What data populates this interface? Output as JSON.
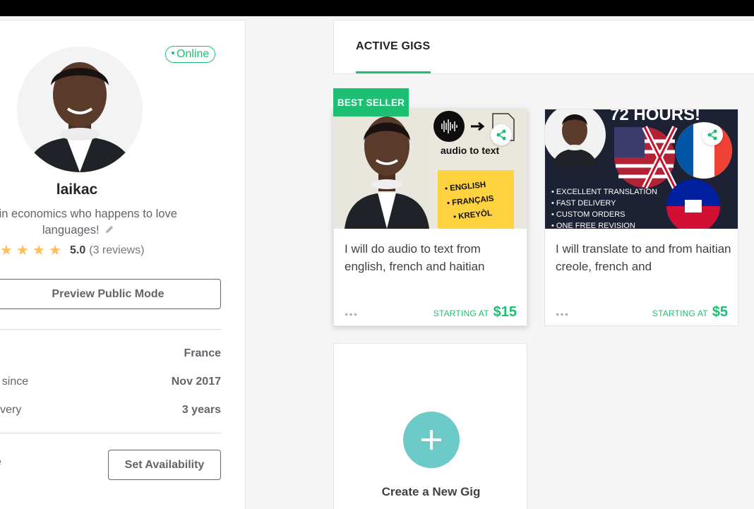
{
  "profile": {
    "status": "Online",
    "username": "laikac",
    "bio": "ent in economics who happens to love languages!",
    "rating_score": "5.0",
    "rating_count": "(3 reviews)",
    "stars": 5,
    "preview_button": "Preview Public Mode",
    "info": [
      {
        "label": "",
        "value": "France"
      },
      {
        "label": "r since",
        "value": "Nov 2017"
      },
      {
        "label": "livery",
        "value": "3 years"
      }
    ],
    "availability_label": "e",
    "availability_button": "Set Availability"
  },
  "tabs": {
    "active": "ACTIVE GIGS"
  },
  "gigs": [
    {
      "badge": "BEST SELLER",
      "thumb_heading": "audio to text",
      "thumb_list": [
        "• ENGLISH",
        "• FRANÇAIS",
        "• KREYÒL"
      ],
      "title": "I will do audio to text from english, french and haitian",
      "starting_label": "STARTING AT",
      "price": "$15"
    },
    {
      "thumb_heading": "72 HOURS!",
      "thumb_list": [
        "• EXCELLENT TRANSLATION",
        "• FAST DELIVERY",
        "• CUSTOM ORDERS",
        "• ONE FREE REVISION"
      ],
      "title": "I will translate to and from haitian creole, french and",
      "starting_label": "STARTING AT",
      "price": "$5"
    }
  ],
  "new_gig": {
    "label": "Create a New Gig"
  },
  "colors": {
    "brand_green": "#1dbf73",
    "star": "#ffbe5b",
    "plus_circle": "#6ccac9"
  },
  "icons": [
    "pencil-icon",
    "star-icon",
    "share-icon",
    "plus-icon",
    "more-dots-icon"
  ]
}
